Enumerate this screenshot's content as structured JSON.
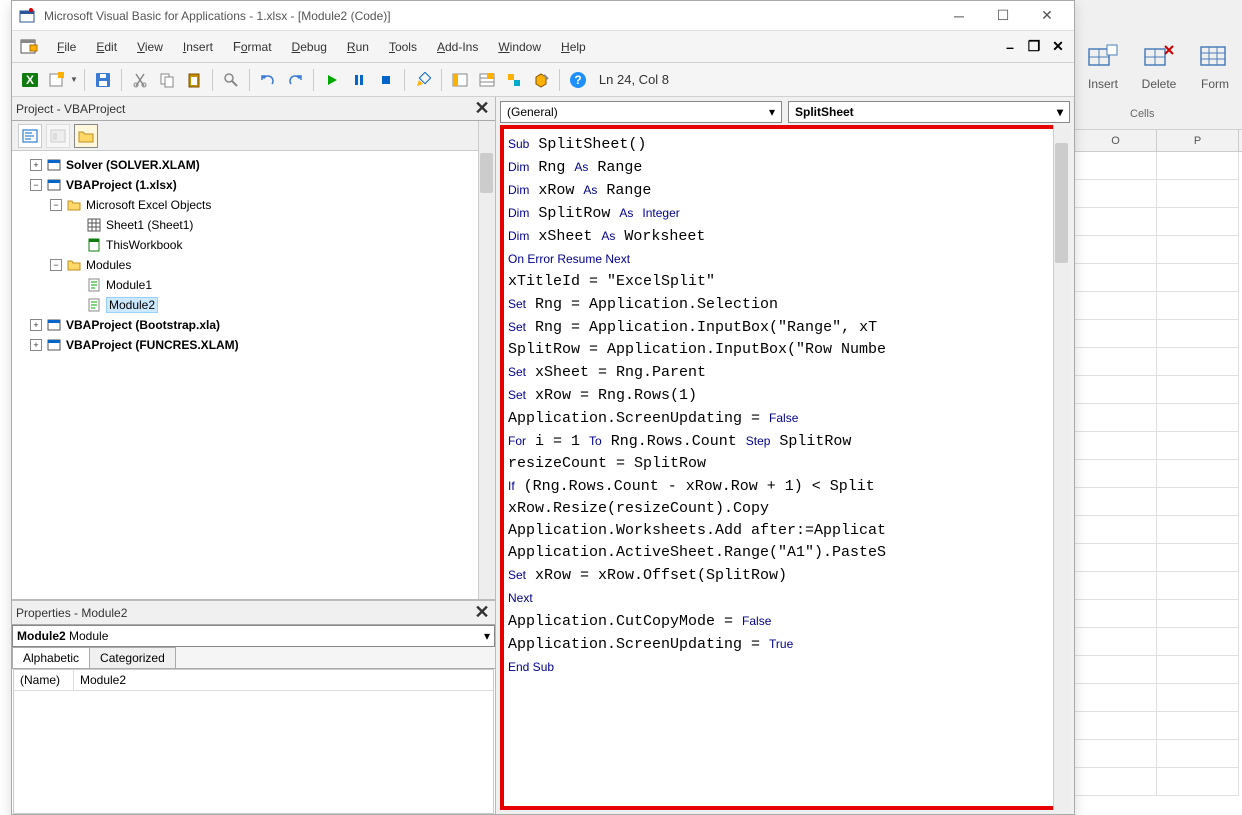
{
  "excel": {
    "ribbon": {
      "insert": "Insert",
      "delete": "Delete",
      "format": "Form",
      "group": "Cells"
    },
    "columns": [
      "O",
      "P"
    ]
  },
  "window": {
    "title": "Microsoft Visual Basic for Applications - 1.xlsx - [Module2 (Code)]"
  },
  "menu": {
    "file": "File",
    "edit": "Edit",
    "view": "View",
    "insert": "Insert",
    "format": "Format",
    "debug": "Debug",
    "run": "Run",
    "tools": "Tools",
    "addins": "Add-Ins",
    "window": "Window",
    "help": "Help"
  },
  "toolbar": {
    "status": "Ln 24, Col 8"
  },
  "project": {
    "title": "Project - VBAProject",
    "tree": {
      "solver": "Solver (SOLVER.XLAM)",
      "vbaproject": "VBAProject (1.xlsx)",
      "excel_objects": "Microsoft Excel Objects",
      "sheet1": "Sheet1 (Sheet1)",
      "thisworkbook": "ThisWorkbook",
      "modules": "Modules",
      "module1": "Module1",
      "module2": "Module2",
      "bootstrap": "VBAProject (Bootstrap.xla)",
      "funcres": "VBAProject (FUNCRES.XLAM)"
    }
  },
  "properties": {
    "title": "Properties - Module2",
    "combo_label": "Module2",
    "combo_type": "Module",
    "tab_alpha": "Alphabetic",
    "tab_cat": "Categorized",
    "name_key": "(Name)",
    "name_val": "Module2"
  },
  "code": {
    "dd_left": "(General)",
    "dd_right": "SplitSheet",
    "lines": [
      [
        [
          "kw",
          "Sub"
        ],
        [
          "",
          " SplitSheet()"
        ]
      ],
      [
        [
          "kw",
          "Dim"
        ],
        [
          "",
          " Rng "
        ],
        [
          "kw",
          "As"
        ],
        [
          "",
          " Range"
        ]
      ],
      [
        [
          "kw",
          "Dim"
        ],
        [
          "",
          " xRow "
        ],
        [
          "kw",
          "As"
        ],
        [
          "",
          " Range"
        ]
      ],
      [
        [
          "kw",
          "Dim"
        ],
        [
          "",
          " SplitRow "
        ],
        [
          "kw",
          "As"
        ],
        [
          "",
          " "
        ],
        [
          "kw",
          "Integer"
        ]
      ],
      [
        [
          "kw",
          "Dim"
        ],
        [
          "",
          " xSheet "
        ],
        [
          "kw",
          "As"
        ],
        [
          "",
          " Worksheet"
        ]
      ],
      [
        [
          "kw",
          "On Error Resume Next"
        ]
      ],
      [
        [
          "",
          "xTitleId = \"ExcelSplit\""
        ]
      ],
      [
        [
          "kw",
          "Set"
        ],
        [
          "",
          " Rng = Application.Selection"
        ]
      ],
      [
        [
          "kw",
          "Set"
        ],
        [
          "",
          " Rng = Application.InputBox(\"Range\", xT"
        ]
      ],
      [
        [
          "",
          "SplitRow = Application.InputBox(\"Row Numbe"
        ]
      ],
      [
        [
          "kw",
          "Set"
        ],
        [
          "",
          " xSheet = Rng.Parent"
        ]
      ],
      [
        [
          "kw",
          "Set"
        ],
        [
          "",
          " xRow = Rng.Rows(1)"
        ]
      ],
      [
        [
          "",
          "Application.ScreenUpdating = "
        ],
        [
          "kw",
          "False"
        ]
      ],
      [
        [
          "kw",
          "For"
        ],
        [
          "",
          " i = 1 "
        ],
        [
          "kw",
          "To"
        ],
        [
          "",
          " Rng.Rows.Count "
        ],
        [
          "kw",
          "Step"
        ],
        [
          "",
          " SplitRow"
        ]
      ],
      [
        [
          "",
          "resizeCount = SplitRow"
        ]
      ],
      [
        [
          "kw",
          "If"
        ],
        [
          "",
          " (Rng.Rows.Count - xRow.Row + 1) < Split"
        ]
      ],
      [
        [
          "",
          "xRow.Resize(resizeCount).Copy"
        ]
      ],
      [
        [
          "",
          "Application.Worksheets.Add after:=Applicat"
        ]
      ],
      [
        [
          "",
          "Application.ActiveSheet.Range(\"A1\").PasteS"
        ]
      ],
      [
        [
          "kw",
          "Set"
        ],
        [
          "",
          " xRow = xRow.Offset(SplitRow)"
        ]
      ],
      [
        [
          "kw",
          "Next"
        ]
      ],
      [
        [
          "",
          "Application.CutCopyMode = "
        ],
        [
          "kw",
          "False"
        ]
      ],
      [
        [
          "",
          "Application.ScreenUpdating = "
        ],
        [
          "kw",
          "True"
        ]
      ],
      [
        [
          "kw",
          "End Sub"
        ]
      ]
    ]
  }
}
